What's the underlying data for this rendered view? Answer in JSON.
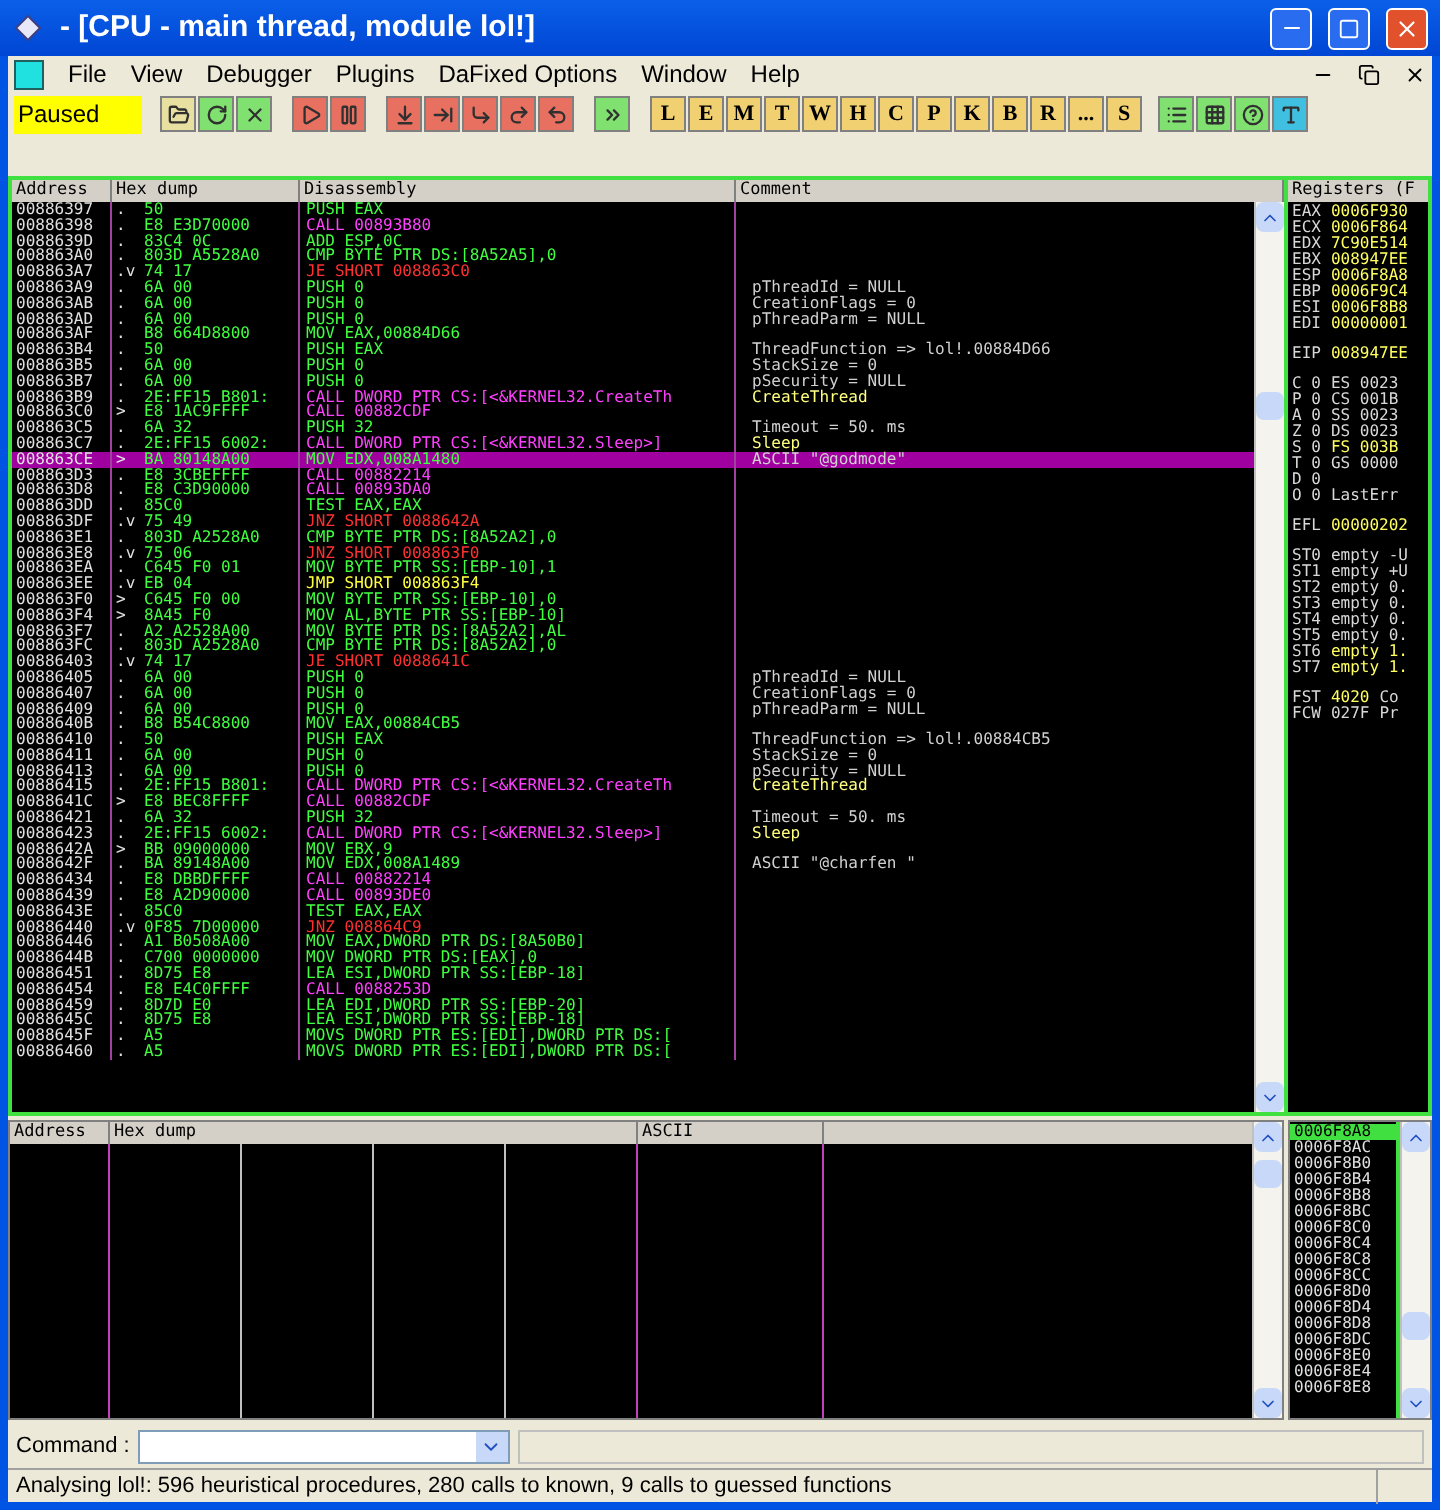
{
  "window": {
    "title": "- [CPU - main thread, module lol!]"
  },
  "menu": [
    "File",
    "View",
    "Debugger",
    "Plugins",
    "DaFixed Options",
    "Window",
    "Help"
  ],
  "toolbar": {
    "status": "Paused",
    "letters": [
      "L",
      "E",
      "M",
      "T",
      "W",
      "H",
      "C",
      "P",
      "K",
      "B",
      "R",
      "...",
      "S"
    ]
  },
  "disassembly": {
    "columns": [
      "Address",
      "Hex dump",
      "Disassembly",
      "Comment"
    ],
    "rows": [
      {
        "addr": "00886397",
        "mark": ".",
        "hex": "50",
        "asm": "PUSH EAX",
        "kind": "plain",
        "selected": false
      },
      {
        "addr": "00886398",
        "mark": ".",
        "hex": "E8 E3D70000",
        "asm": "CALL 00893B80",
        "kind": "call",
        "selected": false
      },
      {
        "addr": "0088639D",
        "mark": ".",
        "hex": "83C4 0C",
        "asm": "ADD ESP,0C",
        "kind": "plain",
        "selected": false
      },
      {
        "addr": "008863A0",
        "mark": ".",
        "hex": "803D A5528A0",
        "asm": "CMP BYTE PTR DS:[8A52A5],0",
        "kind": "plain",
        "selected": false
      },
      {
        "addr": "008863A7",
        "mark": ".v",
        "hex": "74 17",
        "asm": "JE SHORT 008863C0",
        "kind": "jcc",
        "selected": false
      },
      {
        "addr": "008863A9",
        "mark": ".",
        "hex": "6A 00",
        "asm": "PUSH 0",
        "kind": "plain",
        "selected": false,
        "comment": {
          "text": "pThreadId = NULL",
          "kind": "arg"
        }
      },
      {
        "addr": "008863AB",
        "mark": ".",
        "hex": "6A 00",
        "asm": "PUSH 0",
        "kind": "plain",
        "selected": false,
        "comment": {
          "text": "CreationFlags = 0",
          "kind": "arg"
        }
      },
      {
        "addr": "008863AD",
        "mark": ".",
        "hex": "6A 00",
        "asm": "PUSH 0",
        "kind": "plain",
        "selected": false,
        "comment": {
          "text": "pThreadParm = NULL",
          "kind": "arg"
        }
      },
      {
        "addr": "008863AF",
        "mark": ".",
        "hex": "B8 664D8800",
        "asm": "MOV EAX,00884D66",
        "kind": "plain",
        "selected": false
      },
      {
        "addr": "008863B4",
        "mark": ".",
        "hex": "50",
        "asm": "PUSH EAX",
        "kind": "plain",
        "selected": false,
        "comment": {
          "text": "ThreadFunction => lol!.00884D66",
          "kind": "arg"
        }
      },
      {
        "addr": "008863B5",
        "mark": ".",
        "hex": "6A 00",
        "asm": "PUSH 0",
        "kind": "plain",
        "selected": false,
        "comment": {
          "text": "StackSize = 0",
          "kind": "arg"
        }
      },
      {
        "addr": "008863B7",
        "mark": ".",
        "hex": "6A 00",
        "asm": "PUSH 0",
        "kind": "plain",
        "selected": false,
        "comment": {
          "text": "pSecurity = NULL",
          "kind": "arg"
        }
      },
      {
        "addr": "008863B9",
        "mark": ".",
        "hex": "2E:FF15 B801:",
        "asm": "CALL DWORD PTR CS:[<&KERNEL32.CreateTh",
        "kind": "call",
        "selected": false,
        "comment": {
          "text": "CreateThread",
          "kind": "api"
        }
      },
      {
        "addr": "008863C0",
        "mark": ">",
        "hex": "E8 1AC9FFFF",
        "asm": "CALL 00882CDF",
        "kind": "call",
        "selected": false
      },
      {
        "addr": "008863C5",
        "mark": ".",
        "hex": "6A 32",
        "asm": "PUSH 32",
        "kind": "plain",
        "selected": false,
        "comment": {
          "text": "Timeout = 50. ms",
          "kind": "arg"
        }
      },
      {
        "addr": "008863C7",
        "mark": ".",
        "hex": "2E:FF15 6002:",
        "asm": "CALL DWORD PTR CS:[<&KERNEL32.Sleep>]",
        "kind": "call",
        "selected": false,
        "comment": {
          "text": "Sleep",
          "kind": "api"
        }
      },
      {
        "addr": "008863CE",
        "mark": ">",
        "hex": "BA 80148A00",
        "asm": "MOV EDX,008A1480",
        "kind": "plain",
        "selected": true,
        "comment": {
          "text": "ASCII \"@godmode\"",
          "kind": "ascii"
        }
      },
      {
        "addr": "008863D3",
        "mark": ".",
        "hex": "E8 3CBEFFFF",
        "asm": "CALL 00882214",
        "kind": "call",
        "selected": false
      },
      {
        "addr": "008863D8",
        "mark": ".",
        "hex": "E8 C3D90000",
        "asm": "CALL 00893DA0",
        "kind": "call",
        "selected": false
      },
      {
        "addr": "008863DD",
        "mark": ".",
        "hex": "85C0",
        "asm": "TEST EAX,EAX",
        "kind": "plain",
        "selected": false
      },
      {
        "addr": "008863DF",
        "mark": ".v",
        "hex": "75 49",
        "asm": "JNZ SHORT 0088642A",
        "kind": "jcc",
        "selected": false
      },
      {
        "addr": "008863E1",
        "mark": ".",
        "hex": "803D A2528A0",
        "asm": "CMP BYTE PTR DS:[8A52A2],0",
        "kind": "plain",
        "selected": false
      },
      {
        "addr": "008863E8",
        "mark": ".v",
        "hex": "75 06",
        "asm": "JNZ SHORT 008863F0",
        "kind": "jcc",
        "selected": false
      },
      {
        "addr": "008863EA",
        "mark": ".",
        "hex": "C645 F0 01",
        "asm": "MOV BYTE PTR SS:[EBP-10],1",
        "kind": "plain",
        "selected": false
      },
      {
        "addr": "008863EE",
        "mark": ".v",
        "hex": "EB 04",
        "asm": "JMP SHORT 008863F4",
        "kind": "jmp",
        "selected": false
      },
      {
        "addr": "008863F0",
        "mark": ">",
        "hex": "C645 F0 00",
        "asm": "MOV BYTE PTR SS:[EBP-10],0",
        "kind": "plain",
        "selected": false
      },
      {
        "addr": "008863F4",
        "mark": ">",
        "hex": "8A45 F0",
        "asm": "MOV AL,BYTE PTR SS:[EBP-10]",
        "kind": "plain",
        "selected": false
      },
      {
        "addr": "008863F7",
        "mark": ".",
        "hex": "A2 A2528A00",
        "asm": "MOV BYTE PTR DS:[8A52A2],AL",
        "kind": "plain",
        "selected": false
      },
      {
        "addr": "008863FC",
        "mark": ".",
        "hex": "803D A2528A0",
        "asm": "CMP BYTE PTR DS:[8A52A2],0",
        "kind": "plain",
        "selected": false
      },
      {
        "addr": "00886403",
        "mark": ".v",
        "hex": "74 17",
        "asm": "JE SHORT 0088641C",
        "kind": "jcc",
        "selected": false
      },
      {
        "addr": "00886405",
        "mark": ".",
        "hex": "6A 00",
        "asm": "PUSH 0",
        "kind": "plain",
        "selected": false,
        "comment": {
          "text": "pThreadId = NULL",
          "kind": "arg"
        }
      },
      {
        "addr": "00886407",
        "mark": ".",
        "hex": "6A 00",
        "asm": "PUSH 0",
        "kind": "plain",
        "selected": false,
        "comment": {
          "text": "CreationFlags = 0",
          "kind": "arg"
        }
      },
      {
        "addr": "00886409",
        "mark": ".",
        "hex": "6A 00",
        "asm": "PUSH 0",
        "kind": "plain",
        "selected": false,
        "comment": {
          "text": "pThreadParm = NULL",
          "kind": "arg"
        }
      },
      {
        "addr": "0088640B",
        "mark": ".",
        "hex": "B8 B54C8800",
        "asm": "MOV EAX,00884CB5",
        "kind": "plain",
        "selected": false
      },
      {
        "addr": "00886410",
        "mark": ".",
        "hex": "50",
        "asm": "PUSH EAX",
        "kind": "plain",
        "selected": false,
        "comment": {
          "text": "ThreadFunction => lol!.00884CB5",
          "kind": "arg"
        }
      },
      {
        "addr": "00886411",
        "mark": ".",
        "hex": "6A 00",
        "asm": "PUSH 0",
        "kind": "plain",
        "selected": false,
        "comment": {
          "text": "StackSize = 0",
          "kind": "arg"
        }
      },
      {
        "addr": "00886413",
        "mark": ".",
        "hex": "6A 00",
        "asm": "PUSH 0",
        "kind": "plain",
        "selected": false,
        "comment": {
          "text": "pSecurity = NULL",
          "kind": "arg"
        }
      },
      {
        "addr": "00886415",
        "mark": ".",
        "hex": "2E:FF15 B801:",
        "asm": "CALL DWORD PTR CS:[<&KERNEL32.CreateTh",
        "kind": "call",
        "selected": false,
        "comment": {
          "text": "CreateThread",
          "kind": "api"
        }
      },
      {
        "addr": "0088641C",
        "mark": ">",
        "hex": "E8 BEC8FFFF",
        "asm": "CALL 00882CDF",
        "kind": "call",
        "selected": false
      },
      {
        "addr": "00886421",
        "mark": ".",
        "hex": "6A 32",
        "asm": "PUSH 32",
        "kind": "plain",
        "selected": false,
        "comment": {
          "text": "Timeout = 50. ms",
          "kind": "arg"
        }
      },
      {
        "addr": "00886423",
        "mark": ".",
        "hex": "2E:FF15 6002:",
        "asm": "CALL DWORD PTR CS:[<&KERNEL32.Sleep>]",
        "kind": "call",
        "selected": false,
        "comment": {
          "text": "Sleep",
          "kind": "api"
        }
      },
      {
        "addr": "0088642A",
        "mark": ">",
        "hex": "BB 09000000",
        "asm": "MOV EBX,9",
        "kind": "plain",
        "selected": false
      },
      {
        "addr": "0088642F",
        "mark": ".",
        "hex": "BA 89148A00",
        "asm": "MOV EDX,008A1489",
        "kind": "plain",
        "selected": false,
        "comment": {
          "text": "ASCII \"@charfen \"",
          "kind": "ascii"
        }
      },
      {
        "addr": "00886434",
        "mark": ".",
        "hex": "E8 DBBDFFFF",
        "asm": "CALL 00882214",
        "kind": "call",
        "selected": false
      },
      {
        "addr": "00886439",
        "mark": ".",
        "hex": "E8 A2D90000",
        "asm": "CALL 00893DE0",
        "kind": "call",
        "selected": false
      },
      {
        "addr": "0088643E",
        "mark": ".",
        "hex": "85C0",
        "asm": "TEST EAX,EAX",
        "kind": "plain",
        "selected": false
      },
      {
        "addr": "00886440",
        "mark": ".v",
        "hex": "0F85 7D00000",
        "asm": "JNZ 008864C9",
        "kind": "jcc",
        "selected": false
      },
      {
        "addr": "00886446",
        "mark": ".",
        "hex": "A1 B0508A00",
        "asm": "MOV EAX,DWORD PTR DS:[8A50B0]",
        "kind": "plain",
        "selected": false
      },
      {
        "addr": "0088644B",
        "mark": ".",
        "hex": "C700 0000000",
        "asm": "MOV DWORD PTR DS:[EAX],0",
        "kind": "plain",
        "selected": false
      },
      {
        "addr": "00886451",
        "mark": ".",
        "hex": "8D75 E8",
        "asm": "LEA ESI,DWORD PTR SS:[EBP-18]",
        "kind": "plain",
        "selected": false
      },
      {
        "addr": "00886454",
        "mark": ".",
        "hex": "E8 E4C0FFFF",
        "asm": "CALL 0088253D",
        "kind": "call",
        "selected": false
      },
      {
        "addr": "00886459",
        "mark": ".",
        "hex": "8D7D E0",
        "asm": "LEA EDI,DWORD PTR SS:[EBP-20]",
        "kind": "plain",
        "selected": false
      },
      {
        "addr": "0088645C",
        "mark": ".",
        "hex": "8D75 E8",
        "asm": "LEA ESI,DWORD PTR SS:[EBP-18]",
        "kind": "plain",
        "selected": false
      },
      {
        "addr": "0088645F",
        "mark": ".",
        "hex": "A5",
        "asm": "MOVS DWORD PTR ES:[EDI],DWORD PTR DS:[",
        "kind": "plain",
        "selected": false
      },
      {
        "addr": "00886460",
        "mark": ".",
        "hex": "A5",
        "asm": "MOVS DWORD PTR ES:[EDI],DWORD PTR DS:[",
        "kind": "plain",
        "selected": false
      }
    ]
  },
  "registers": {
    "title": "Registers (F",
    "groups": [
      [
        [
          {
            "text": "EAX",
            "changed": false
          },
          {
            "text": "0006F930",
            "changed": true
          }
        ],
        [
          {
            "text": "ECX",
            "changed": false
          },
          {
            "text": "0006F864",
            "changed": true
          }
        ],
        [
          {
            "text": "EDX",
            "changed": false
          },
          {
            "text": "7C90E514",
            "changed": true
          }
        ],
        [
          {
            "text": "EBX",
            "changed": false
          },
          {
            "text": "008947EE",
            "changed": true
          }
        ],
        [
          {
            "text": "ESP",
            "changed": false
          },
          {
            "text": "0006F8A8",
            "changed": true
          }
        ],
        [
          {
            "text": "EBP",
            "changed": false
          },
          {
            "text": "0006F9C4",
            "changed": true
          }
        ],
        [
          {
            "text": "ESI",
            "changed": false
          },
          {
            "text": "0006F8B8",
            "changed": true
          }
        ],
        [
          {
            "text": "EDI",
            "changed": false
          },
          {
            "text": "00000001",
            "changed": true
          }
        ]
      ],
      [
        [
          {
            "text": "EIP",
            "changed": false
          },
          {
            "text": "008947EE",
            "changed": true
          }
        ]
      ],
      [
        [
          {
            "text": "C 0",
            "changed": false
          },
          {
            "text": "ES 0023",
            "changed": false
          }
        ],
        [
          {
            "text": "P 0",
            "changed": false
          },
          {
            "text": "CS 001B",
            "changed": false
          }
        ],
        [
          {
            "text": "A 0",
            "changed": false
          },
          {
            "text": "SS 0023",
            "changed": false
          }
        ],
        [
          {
            "text": "Z 0",
            "changed": false
          },
          {
            "text": "DS 0023",
            "changed": false
          }
        ],
        [
          {
            "text": "S 0",
            "changed": false
          },
          {
            "text": "FS 003B",
            "changed": true
          }
        ],
        [
          {
            "text": "T 0",
            "changed": false
          },
          {
            "text": "GS 0000",
            "changed": false
          }
        ],
        [
          {
            "text": "D 0",
            "changed": false
          }
        ],
        [
          {
            "text": "O 0",
            "changed": false
          },
          {
            "text": "LastErr",
            "changed": false
          }
        ]
      ],
      [
        [
          {
            "text": "EFL",
            "changed": false
          },
          {
            "text": "00000202",
            "changed": true
          }
        ]
      ],
      [
        [
          {
            "text": "ST0",
            "changed": false
          },
          {
            "text": "empty -U",
            "changed": false
          }
        ],
        [
          {
            "text": "ST1",
            "changed": false
          },
          {
            "text": "empty +U",
            "changed": false
          }
        ],
        [
          {
            "text": "ST2",
            "changed": false
          },
          {
            "text": "empty 0.",
            "changed": false
          }
        ],
        [
          {
            "text": "ST3",
            "changed": false
          },
          {
            "text": "empty 0.",
            "changed": false
          }
        ],
        [
          {
            "text": "ST4",
            "changed": false
          },
          {
            "text": "empty 0.",
            "changed": false
          }
        ],
        [
          {
            "text": "ST5",
            "changed": false
          },
          {
            "text": "empty 0.",
            "changed": false
          }
        ],
        [
          {
            "text": "ST6",
            "changed": false
          },
          {
            "text": "empty 1.",
            "changed": true
          }
        ],
        [
          {
            "text": "ST7",
            "changed": false
          },
          {
            "text": "empty 1.",
            "changed": true
          }
        ]
      ],
      [
        [
          {
            "text": "FST",
            "changed": false
          },
          {
            "text": "4020",
            "changed": true
          },
          {
            "text": "Co",
            "changed": false
          }
        ],
        [
          {
            "text": "FCW",
            "changed": false
          },
          {
            "text": "027F",
            "changed": false
          },
          {
            "text": "Pr",
            "changed": false
          }
        ]
      ]
    ]
  },
  "dump": {
    "columns": [
      "Address",
      "Hex dump",
      "ASCII"
    ]
  },
  "stack": [
    {
      "addr": "0006F8A8",
      "selected": true
    },
    {
      "addr": "0006F8AC",
      "selected": false
    },
    {
      "addr": "0006F8B0",
      "selected": false
    },
    {
      "addr": "0006F8B4",
      "selected": false
    },
    {
      "addr": "0006F8B8",
      "selected": false
    },
    {
      "addr": "0006F8BC",
      "selected": false
    },
    {
      "addr": "0006F8C0",
      "selected": false
    },
    {
      "addr": "0006F8C4",
      "selected": false
    },
    {
      "addr": "0006F8C8",
      "selected": false
    },
    {
      "addr": "0006F8CC",
      "selected": false
    },
    {
      "addr": "0006F8D0",
      "selected": false
    },
    {
      "addr": "0006F8D4",
      "selected": false
    },
    {
      "addr": "0006F8D8",
      "selected": false
    },
    {
      "addr": "0006F8DC",
      "selected": false
    },
    {
      "addr": "0006F8E0",
      "selected": false
    },
    {
      "addr": "0006F8E4",
      "selected": false
    },
    {
      "addr": "0006F8E8",
      "selected": false
    }
  ],
  "command": {
    "label": "Command :"
  },
  "status_bar": "Analysing lol!: 596 heuristical procedures, 280 calls to known, 9 calls to guessed functions"
}
